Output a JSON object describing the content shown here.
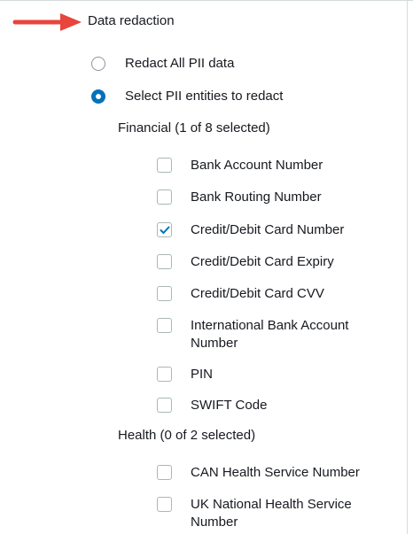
{
  "section": {
    "title": "Data redaction"
  },
  "options": {
    "redact_all": "Redact All PII data",
    "select_entities": "Select PII entities to redact"
  },
  "financial": {
    "title": "Financial (1 of 8 selected)",
    "items": [
      {
        "label": "Bank Account Number",
        "checked": false
      },
      {
        "label": "Bank Routing Number",
        "checked": false
      },
      {
        "label": "Credit/Debit Card Number",
        "checked": true
      },
      {
        "label": "Credit/Debit Card Expiry",
        "checked": false
      },
      {
        "label": "Credit/Debit Card CVV",
        "checked": false
      },
      {
        "label": "International Bank Account Number",
        "checked": false
      },
      {
        "label": "PIN",
        "checked": false
      },
      {
        "label": "SWIFT Code",
        "checked": false
      }
    ]
  },
  "health": {
    "title": "Health (0 of 2 selected)",
    "items": [
      {
        "label": "CAN Health Service Number",
        "checked": false
      },
      {
        "label": "UK National Health Service Number",
        "checked": false
      }
    ]
  },
  "colors": {
    "accent": "#0073bb",
    "arrow": "#e8453c",
    "text": "#16191f"
  },
  "icons": {
    "pointer_arrow": "arrow-right-icon",
    "check": "checkmark-icon"
  }
}
